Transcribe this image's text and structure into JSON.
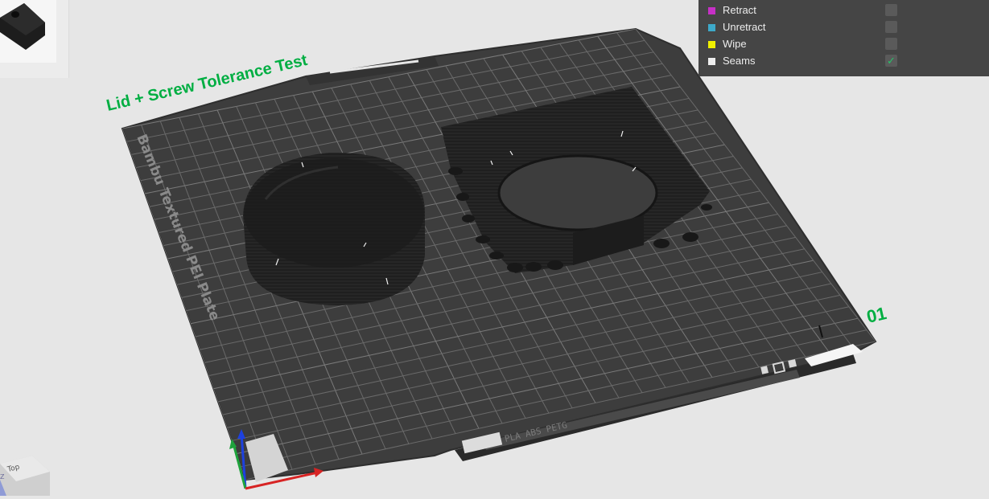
{
  "plate": {
    "title": "Lid + Screw Tolerance Test",
    "plate_type_label": "Bambu Textured PEI Plate",
    "plate_number": "01",
    "filament_strip": "PLA ABS PETG"
  },
  "legend": {
    "items": [
      {
        "label": "Retract",
        "color": "#c630c6",
        "checked": false
      },
      {
        "label": "Unretract",
        "color": "#3da9c9",
        "checked": false
      },
      {
        "label": "Wipe",
        "color": "#f0f000",
        "checked": false
      },
      {
        "label": "Seams",
        "color": "#eeeeee",
        "checked": true
      }
    ]
  },
  "view_cube": {
    "face_label": "Top",
    "axis_label": "Z"
  },
  "colors": {
    "accent_green": "#00ae42",
    "plate": "#3d3d3d",
    "grid": "#6a6a6a",
    "model": "#202020"
  }
}
